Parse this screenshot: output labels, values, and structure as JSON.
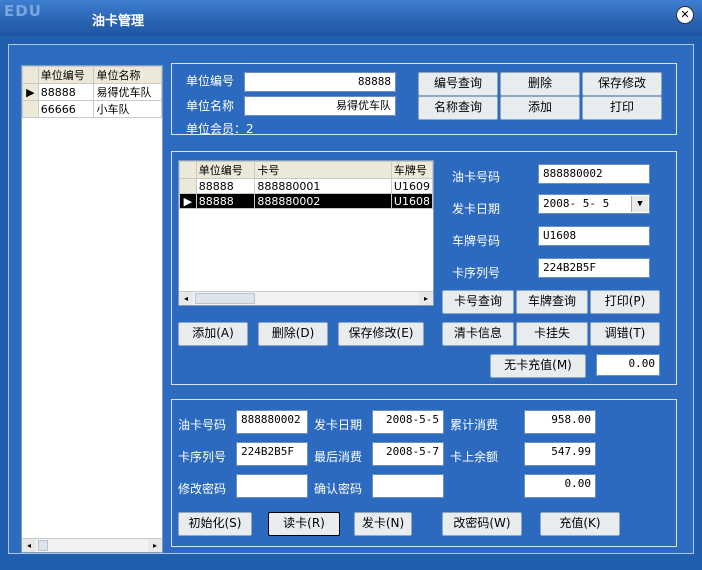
{
  "window": {
    "brand": "EDU",
    "title": "油卡管理"
  },
  "units_grid": {
    "headers": [
      "单位编号",
      "单位名称"
    ],
    "rows": [
      {
        "code": "88888",
        "name": "易得优车队",
        "indicator": "▶"
      },
      {
        "code": "66666",
        "name": "小车队",
        "indicator": ""
      }
    ]
  },
  "unit_panel": {
    "code_label": "单位编号",
    "code_value": "88888",
    "name_label": "单位名称",
    "name_value": "易得优车队",
    "members_label": "单位会员：2",
    "buttons": [
      "编号查询",
      "删除",
      "保存修改",
      "名称查询",
      "添加",
      "打印"
    ]
  },
  "cards_panel": {
    "grid_headers": [
      "单位编号",
      "卡号",
      "车牌号"
    ],
    "grid_rows": [
      {
        "unit": "88888",
        "card": "888880001",
        "plate": "U1609",
        "indicator": ""
      },
      {
        "unit": "88888",
        "card": "888880002",
        "plate": "U1608",
        "indicator": "▶"
      }
    ],
    "card_no_label": "油卡号码",
    "card_no_value": "888880002",
    "issue_date_label": "发卡日期",
    "issue_date_value": "2008- 5- 5",
    "plate_label": "车牌号码",
    "plate_value": "U1608",
    "serial_label": "卡序列号",
    "serial_value": "224B2B5F",
    "buttons_row1": [
      "卡号查询",
      "车牌查询",
      "打印(P)"
    ],
    "buttons_row2": [
      "清卡信息",
      "卡挂失",
      "调错(T)"
    ],
    "left_buttons": [
      "添加(A)",
      "删除(D)",
      "保存修改(E)"
    ],
    "no_card_recharge": "无卡充值(M)",
    "no_card_amount": "0.00"
  },
  "reader_panel": {
    "card_no_label": "油卡号码",
    "card_no_value": "888880002",
    "issue_date_label": "发卡日期",
    "issue_date_value": "2008-5-5",
    "total_label": "累计消费",
    "total_value": "958.00",
    "serial_label": "卡序列号",
    "serial_value": "224B2B5F",
    "last_label": "最后消费",
    "last_value": "2008-5-7",
    "balance_label": "卡上余额",
    "balance_value": "547.99",
    "change_pwd_label": "修改密码",
    "change_pwd_value": "",
    "confirm_pwd_label": "确认密码",
    "confirm_pwd_value": "",
    "amount_value": "0.00",
    "buttons": [
      "初始化(S)",
      "读卡(R)",
      "发卡(N)",
      "改密码(W)",
      "充值(K)"
    ]
  }
}
